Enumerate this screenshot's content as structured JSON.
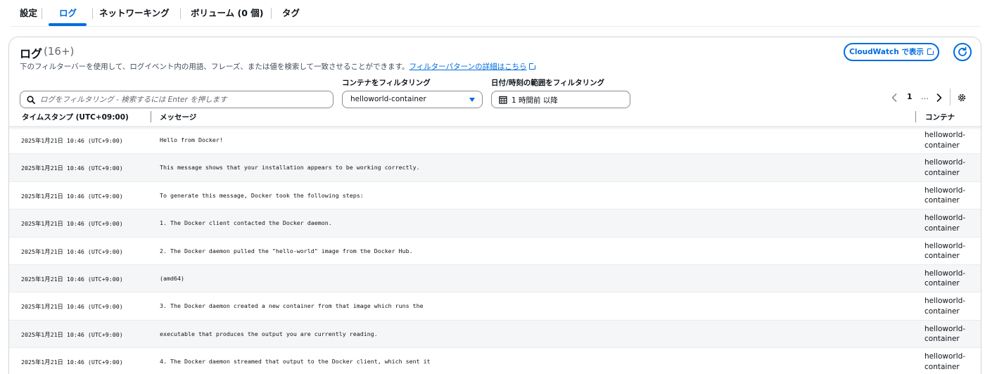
{
  "tabs": [
    {
      "label": "設定"
    },
    {
      "label": "ログ"
    },
    {
      "label": "ネットワーキング"
    },
    {
      "label": "ボリューム (0 個)"
    },
    {
      "label": "タグ"
    }
  ],
  "panel": {
    "title": "ログ",
    "count": "(16+)",
    "description": "下のフィルターバーを使用して、ログイベント内の用語、フレーズ、または値を検索して一致させることができます。",
    "description_link": "フィルターパターンの詳細はこちら",
    "cloudwatch_label": "CloudWatch で表示",
    "search_placeholder": "ログをフィルタリング - 検索するには Enter を押します",
    "container_filter_label": "コンテナをフィルタリング",
    "container_filter_value": "helloworld-container",
    "date_filter_label": "日付/時刻の範囲をフィルタリング",
    "date_filter_value": "1 時間前 以降",
    "pagination": {
      "current_page": "1",
      "ellipsis": "…"
    },
    "accent_color": "#006ce0"
  },
  "table": {
    "columns": [
      "タイムスタンプ (UTC+09:00)",
      "メッセージ",
      "コンテナ"
    ],
    "rows": [
      {
        "timestamp": "2025年1月21日 10:46 (UTC+9:00)",
        "message": "Hello from Docker!",
        "container": "helloworld-container"
      },
      {
        "timestamp": "2025年1月21日 10:46 (UTC+9:00)",
        "message": "This message shows that your installation appears to be working correctly.",
        "container": "helloworld-container"
      },
      {
        "timestamp": "2025年1月21日 10:46 (UTC+9:00)",
        "message": "To generate this message, Docker took the following steps:",
        "container": "helloworld-container"
      },
      {
        "timestamp": "2025年1月21日 10:46 (UTC+9:00)",
        "message": "1. The Docker client contacted the Docker daemon.",
        "container": "helloworld-container"
      },
      {
        "timestamp": "2025年1月21日 10:46 (UTC+9:00)",
        "message": "2. The Docker daemon pulled the \"hello-world\" image from the Docker Hub.",
        "container": "helloworld-container"
      },
      {
        "timestamp": "2025年1月21日 10:46 (UTC+9:00)",
        "message": "(amd64)",
        "container": "helloworld-container"
      },
      {
        "timestamp": "2025年1月21日 10:46 (UTC+9:00)",
        "message": "3. The Docker daemon created a new container from that image which runs the",
        "container": "helloworld-container"
      },
      {
        "timestamp": "2025年1月21日 10:46 (UTC+9:00)",
        "message": "executable that produces the output you are currently reading.",
        "container": "helloworld-container"
      },
      {
        "timestamp": "2025年1月21日 10:46 (UTC+9:00)",
        "message": "4. The Docker daemon streamed that output to the Docker client, which sent it",
        "container": "helloworld-container"
      }
    ]
  }
}
